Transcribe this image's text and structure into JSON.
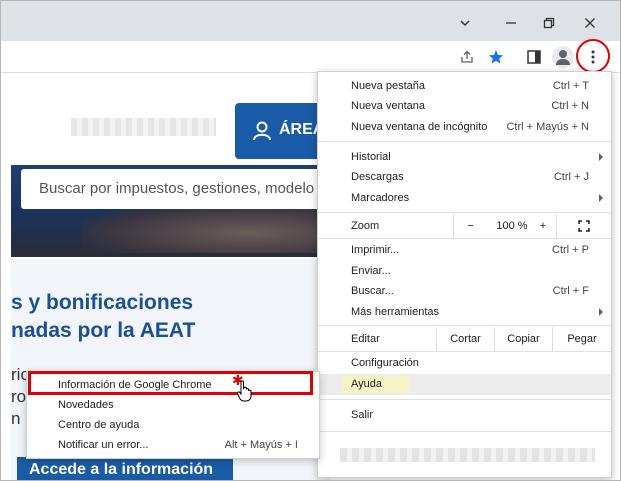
{
  "toolbar": {
    "icons": [
      "share-icon",
      "star-icon",
      "sidepanel-icon",
      "profile-icon",
      "kebab-menu-icon"
    ]
  },
  "page": {
    "area_button_label": "ÁREA",
    "search_placeholder": "Buscar por impuestos, gestiones, modelo",
    "headline_1": "s y bonificaciones",
    "headline_2": "nadas por la AEAT",
    "body_1": "ric",
    "body_2": "ro",
    "body_3": "n",
    "bottom_button_label": "Accede a la información"
  },
  "menu": {
    "nueva_pestana": {
      "label": "Nueva pestaña",
      "shortcut": "Ctrl + T"
    },
    "nueva_ventana": {
      "label": "Nueva ventana",
      "shortcut": "Ctrl + N"
    },
    "incognito": {
      "label": "Nueva ventana de incógnito",
      "shortcut": "Ctrl + Mayús + N"
    },
    "historial": {
      "label": "Historial"
    },
    "descargas": {
      "label": "Descargas",
      "shortcut": "Ctrl + J"
    },
    "marcadores": {
      "label": "Marcadores"
    },
    "zoom": {
      "label": "Zoom",
      "minus": "−",
      "value": "100 %",
      "plus": "+"
    },
    "imprimir": {
      "label": "Imprimir...",
      "shortcut": "Ctrl + P"
    },
    "enviar": {
      "label": "Enviar..."
    },
    "buscar": {
      "label": "Buscar...",
      "shortcut": "Ctrl + F"
    },
    "mas_herramientas": {
      "label": "Más herramientas"
    },
    "editar": {
      "label": "Editar",
      "cortar": "Cortar",
      "copiar": "Copiar",
      "pegar": "Pegar"
    },
    "configuracion": {
      "label": "Configuración"
    },
    "ayuda": {
      "label": "Ayuda"
    },
    "salir": {
      "label": "Salir"
    }
  },
  "submenu": {
    "info_chrome": {
      "label": "Información de Google Chrome"
    },
    "novedades": {
      "label": "Novedades"
    },
    "centro_ayuda": {
      "label": "Centro de ayuda"
    },
    "notificar": {
      "label": "Notificar un error...",
      "shortcut": "Alt + Mayús + I"
    }
  }
}
